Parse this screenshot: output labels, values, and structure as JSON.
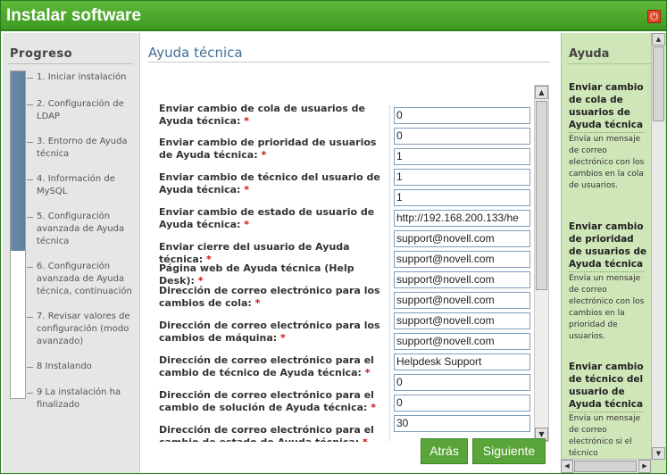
{
  "window": {
    "title": "Instalar software"
  },
  "progress": {
    "title": "Progreso",
    "fill_fraction": 0.55,
    "steps": [
      "1. Iniciar instalación",
      "2. Configuración de LDAP",
      "3. Entorno de Ayuda técnica",
      "4. Información de MySQL",
      "5. Configuración avanzada de Ayuda técnica",
      "6. Configuración avanzada de Ayuda técnica, continuación",
      "7. Revisar valores de configuración (modo avanzado)",
      "8 Instalando",
      "9 La instalación ha finalizado"
    ]
  },
  "main": {
    "title": "Ayuda técnica",
    "fields": [
      {
        "label": "Enviar cambio de cola de usuarios de Ayuda técnica:",
        "value": "0"
      },
      {
        "label": "Enviar cambio de prioridad de usuarios de Ayuda técnica:",
        "value": "0"
      },
      {
        "label": "Enviar cambio de técnico del usuario de Ayuda técnica:",
        "value": "1"
      },
      {
        "label": "",
        "value": "1"
      },
      {
        "label": "Enviar cambio de estado de usuario de Ayuda técnica:",
        "value": "1"
      },
      {
        "label": "",
        "value": "http://192.168.200.133/he"
      },
      {
        "label": "Enviar cierre del usuario de Ayuda técnica:",
        "value": "support@novell.com"
      },
      {
        "label": "Página web de Ayuda técnica (Help Desk):",
        "value": "support@novell.com"
      },
      {
        "label": "Dirección de correo electrónico para los cambios de cola:",
        "value": "support@novell.com"
      },
      {
        "label": "",
        "value": "support@novell.com"
      },
      {
        "label": "Dirección de correo electrónico para los cambios de máquina:",
        "value": "support@novell.com"
      },
      {
        "label": "",
        "value": "support@novell.com"
      },
      {
        "label": "Dirección de correo electrónico para el cambio de técnico de Ayuda técnica:",
        "value": "Helpdesk Support"
      },
      {
        "label": "",
        "value": "0"
      },
      {
        "label": "Dirección de correo electrónico para el cambio de solución de Ayuda técnica:",
        "value": "0"
      },
      {
        "label": "",
        "value": "30"
      },
      {
        "label": "Dirección de correo electrónico para el cambio de estado de Ayuda técnica:",
        "value": ""
      }
    ],
    "back_label": "Atrás",
    "next_label": "Siguiente"
  },
  "help": {
    "title": "Ayuda",
    "entries": [
      {
        "heading": "Enviar cambio de cola de usuarios de Ayuda técnica",
        "text": "Envía un mensaje de correo electrónico con los cambios en la cola de usuarios."
      },
      {
        "heading": "Enviar cambio de prioridad de usuarios de Ayuda técnica",
        "text": "Envía un mensaje de correo electrónico con los cambios en la prioridad de usuarios."
      },
      {
        "heading": "Enviar cambio de técnico del usuario de Ayuda técnica",
        "text": "Envía un mensaje de correo electrónico si el técnico"
      }
    ]
  },
  "colors": {
    "title_bar": "#4aa82a",
    "button": "#5aa53a",
    "help_bg": "#cfe6b8",
    "link_title": "#44709a",
    "required": "#d01010"
  }
}
